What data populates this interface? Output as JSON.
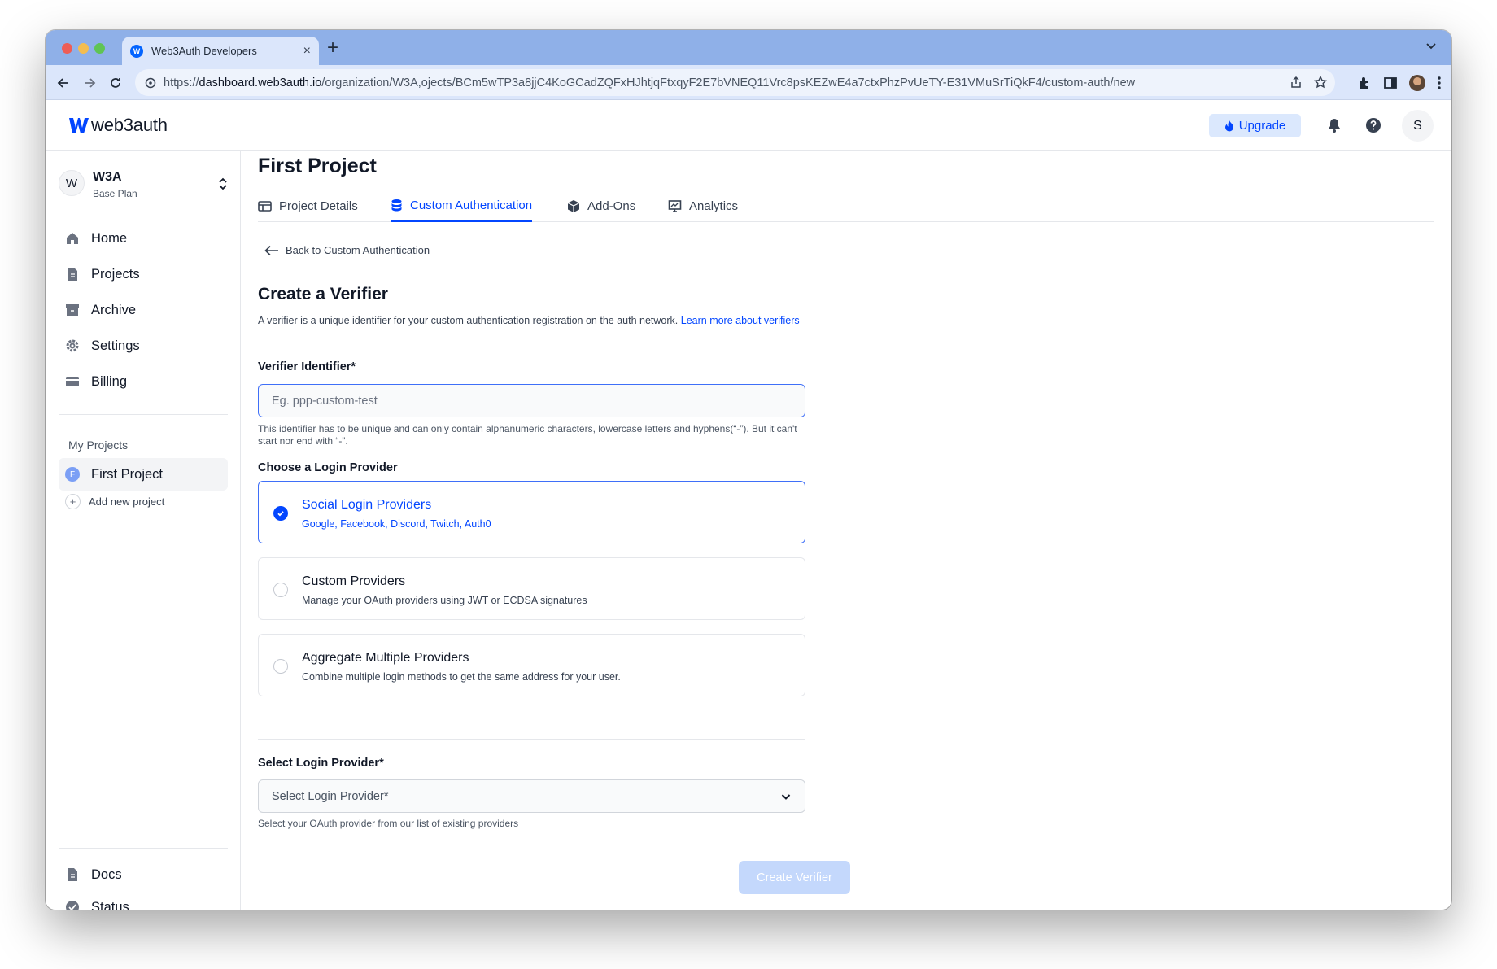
{
  "browser": {
    "tab_title": "Web3Auth Developers",
    "favicon_letter": "W",
    "url_prefix": "https://",
    "url_host": "dashboard.web3auth.io",
    "url_path": "/organization/W3A,ojects/BCm5wTP3a8jjC4KoGCadZQFxHJhtjqFtxqyF2E7bVNEQ11Vrc8psKEZwE4a7ctxPhzPvUeTY-E31VMuSrTiQkF4/custom-auth/new"
  },
  "header": {
    "logo_text": "web3auth",
    "upgrade_label": "Upgrade",
    "avatar_letter": "S"
  },
  "sidebar": {
    "org": {
      "avatar_letter": "W",
      "name": "W3A",
      "plan": "Base Plan"
    },
    "nav": [
      {
        "label": "Home",
        "icon": "home-icon"
      },
      {
        "label": "Projects",
        "icon": "document-icon"
      },
      {
        "label": "Archive",
        "icon": "archive-icon"
      },
      {
        "label": "Settings",
        "icon": "gear-icon"
      },
      {
        "label": "Billing",
        "icon": "credit-card-icon"
      }
    ],
    "my_projects_label": "My Projects",
    "projects": [
      {
        "badge": "F",
        "label": "First Project"
      }
    ],
    "add_project_label": "Add new project",
    "footer": [
      {
        "label": "Docs",
        "icon": "document-icon"
      },
      {
        "label": "Status",
        "icon": "check-circle-icon"
      }
    ]
  },
  "main": {
    "page_title": "First Project",
    "tabs": [
      {
        "label": "Project Details",
        "active": false
      },
      {
        "label": "Custom Authentication",
        "active": true
      },
      {
        "label": "Add-Ons",
        "active": false
      },
      {
        "label": "Analytics",
        "active": false
      }
    ],
    "back_label": "Back to Custom Authentication",
    "section_title": "Create a Verifier",
    "section_desc": "A verifier is a unique identifier for your custom authentication registration on the auth network.",
    "learn_more": "Learn more about verifiers",
    "verifier": {
      "label": "Verifier Identifier*",
      "placeholder": "Eg. ppp-custom-test",
      "value": "",
      "helper": "This identifier has to be unique and can only contain alphanumeric characters, lowercase letters and hyphens(“-”). But it can't start nor end with “-”."
    },
    "provider_label": "Choose a Login Provider",
    "providers": [
      {
        "title": "Social Login Providers",
        "subtitle": "Google, Facebook, Discord, Twitch, Auth0",
        "selected": true
      },
      {
        "title": "Custom Providers",
        "subtitle": "Manage your OAuth providers using JWT or ECDSA signatures",
        "selected": false
      },
      {
        "title": "Aggregate Multiple Providers",
        "subtitle": "Combine multiple login methods to get the same address for your user.",
        "selected": false
      }
    ],
    "select": {
      "label": "Select Login Provider*",
      "placeholder": "Select Login Provider*",
      "helper": "Select your OAuth provider from our list of existing providers"
    },
    "create_button": "Create Verifier"
  },
  "colors": {
    "accent": "#0346ff",
    "chrome": "#8fb0e8",
    "disabled_button": "#c4d8fc"
  }
}
